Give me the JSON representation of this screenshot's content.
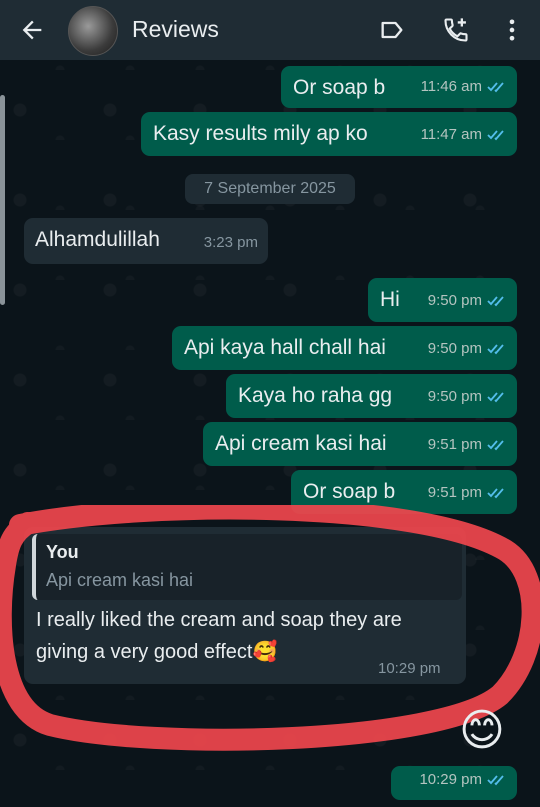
{
  "header": {
    "title": "Reviews",
    "icons": [
      "back-arrow-icon",
      "avatar",
      "label-icon",
      "call-add-icon",
      "more-vert-icon"
    ]
  },
  "messages": [
    {
      "text": "Or soap b",
      "time": "11:46 am",
      "dir": "out"
    },
    {
      "text": "Kasy  results mily ap ko",
      "time": "11:47 am",
      "dir": "out"
    },
    {
      "text": "Alhamdulillah",
      "time": "3:23 pm",
      "dir": "in"
    },
    {
      "text": "Hi",
      "time": "9:50 pm",
      "dir": "out"
    },
    {
      "text": "Api kaya hall chall hai",
      "time": "9:50 pm",
      "dir": "out"
    },
    {
      "text": "Kaya ho raha gg",
      "time": "9:50 pm",
      "dir": "out"
    },
    {
      "text": "Api cream kasi hai",
      "time": "9:51 pm",
      "dir": "out"
    },
    {
      "text": "Or soap b",
      "time": "9:51 pm",
      "dir": "out"
    }
  ],
  "date_divider": "7 September 2025",
  "reply": {
    "quote_author": "You",
    "quote_text": "Api cream kasi hai",
    "text": "I really liked the cream and soap they are giving a very good effect",
    "emoji": "🥰",
    "time": "10:29 pm"
  },
  "last_message": {
    "emoji": "😊",
    "time": "10:29 pm"
  },
  "colors": {
    "background": "#0b141a",
    "outgoing_bubble": "#005c4b",
    "incoming_bubble": "#1f2c34",
    "read_ticks": "#53bdeb",
    "annotation_circle": "#f0474d"
  }
}
